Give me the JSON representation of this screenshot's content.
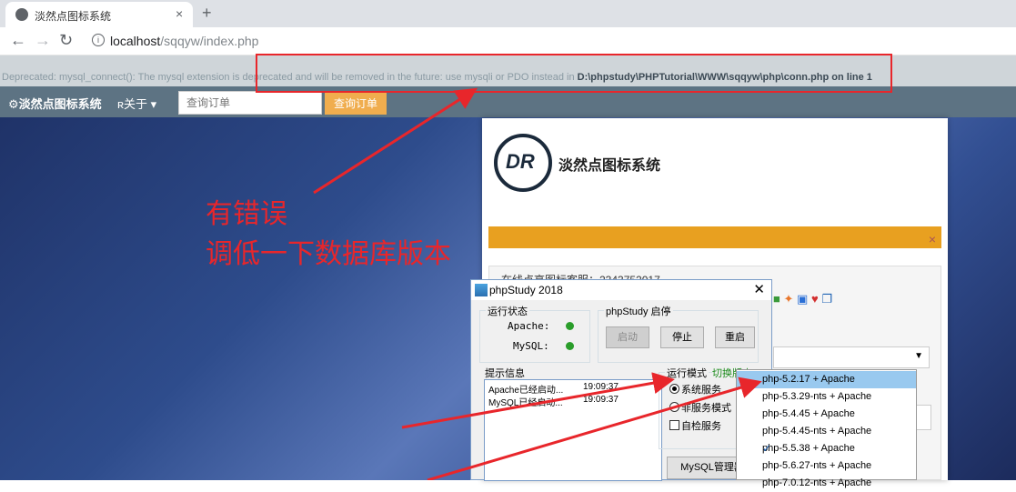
{
  "browser": {
    "tab_title": "淡然点图标系统",
    "tab_close": "×",
    "new_tab": "+",
    "url_host": "localhost",
    "url_path": "/sqqyw/index.php"
  },
  "warning": {
    "label": "Deprecated",
    "text": ": mysql_connect(): The mysql extension is deprecated and will be removed in the future: use mysqli or PDO instead in ",
    "path": "D:\\phpstudy\\PHPTutorial\\WWW\\sqqyw\\php\\conn.php",
    "suffix": " on line 1"
  },
  "navbar": {
    "brand": "淡然点图标系统",
    "about": "关于",
    "search_placeholder": "查询订单",
    "search_button": "查询订单"
  },
  "card": {
    "site_title": "淡然点图标系统",
    "logo_text": "DR",
    "close": "×",
    "online_text": "在线点亮图标客服：2343752017"
  },
  "annotation": {
    "line1": "有错误",
    "line2": "调低一下数据库版本"
  },
  "phpstudy": {
    "title": "phpStudy 2018",
    "close": "✕",
    "status_group": "运行状态",
    "apache_label": "Apache:",
    "mysql_label": "MySQL:",
    "control_group": "phpStudy 启停",
    "start": "启动",
    "stop": "停止",
    "restart": "重启",
    "log_group": "提示信息",
    "log": [
      {
        "text": "Apache已经启动...",
        "time": "19:09:37"
      },
      {
        "text": "MySQL已经启动...",
        "time": "19:09:37"
      }
    ],
    "mode_group": "运行模式",
    "switch_version": "切换版本",
    "mode_system": "系统服务",
    "mode_nonservice": "非服务模式",
    "self_check": "自检服务",
    "mysql_manager": "MySQL管理器"
  },
  "versions": [
    {
      "label": "php-5.2.17 + Apache",
      "highlight": true,
      "checked": false
    },
    {
      "label": "php-5.3.29-nts + Apache",
      "highlight": false,
      "checked": false
    },
    {
      "label": "php-5.4.45 + Apache",
      "highlight": false,
      "checked": false
    },
    {
      "label": "php-5.4.45-nts + Apache",
      "highlight": false,
      "checked": false
    },
    {
      "label": "php-5.5.38 + Apache",
      "highlight": false,
      "checked": true
    },
    {
      "label": "php-5.6.27-nts + Apache",
      "highlight": false,
      "checked": false
    },
    {
      "label": "php-7.0.12-nts + Apache",
      "highlight": false,
      "checked": false
    }
  ]
}
